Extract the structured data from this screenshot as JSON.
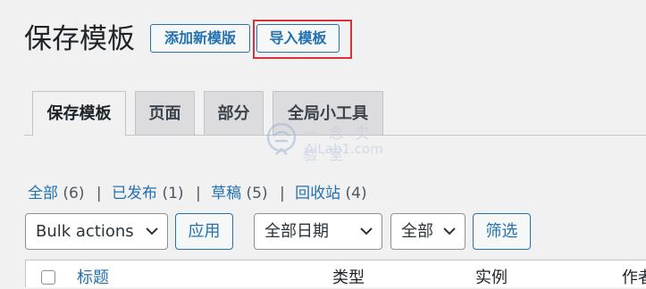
{
  "header": {
    "title": "保存模板",
    "add_new_label": "添加新模版",
    "import_label": "导入模板"
  },
  "tabs": [
    {
      "label": "保存模板",
      "active": true
    },
    {
      "label": "页面",
      "active": false
    },
    {
      "label": "部分",
      "active": false
    },
    {
      "label": "全局小工具",
      "active": false
    }
  ],
  "watermark": {
    "line1": "一 念 实 验 室",
    "line2": "AiLab1.com"
  },
  "filters": {
    "views": [
      {
        "label": "全部",
        "count": "(6)"
      },
      {
        "label": "已发布",
        "count": "(1)"
      },
      {
        "label": "草稿",
        "count": "(5)"
      },
      {
        "label": "回收站",
        "count": "(4)"
      }
    ],
    "separator": "|",
    "bulk_actions_selected": "Bulk actions",
    "apply_label": "应用",
    "date_selected": "全部日期",
    "type_selected": "全部",
    "filter_label": "筛选"
  },
  "table": {
    "columns": [
      "标题",
      "类型",
      "实例",
      "作者"
    ]
  },
  "colors": {
    "accent": "#2271b1",
    "highlight": "#d6323c",
    "background": "#f1f1f1"
  }
}
